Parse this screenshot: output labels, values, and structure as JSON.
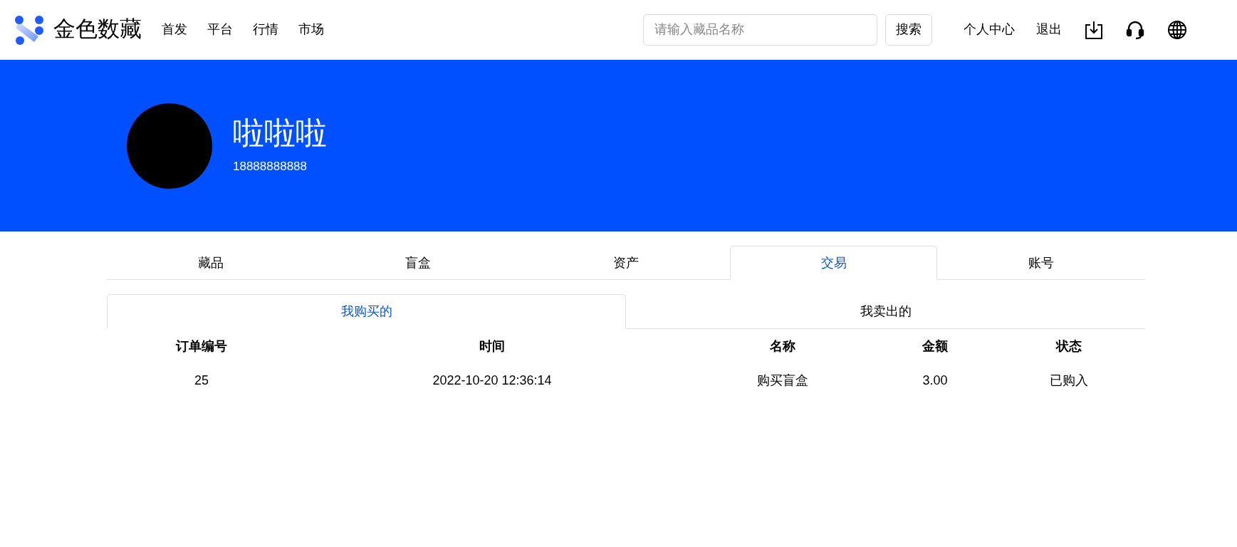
{
  "header": {
    "brand": "金色数藏",
    "nav": [
      "首发",
      "平台",
      "行情",
      "市场"
    ],
    "search": {
      "placeholder": "请输入藏品名称",
      "button": "搜索"
    },
    "links": [
      "个人中心",
      "退出"
    ]
  },
  "profile": {
    "name": "啦啦啦",
    "phone": "18888888888"
  },
  "tabs": [
    {
      "label": "藏品",
      "selected": false
    },
    {
      "label": "盲盒",
      "selected": false
    },
    {
      "label": "资产",
      "selected": false
    },
    {
      "label": "交易",
      "selected": true
    },
    {
      "label": "账号",
      "selected": false
    }
  ],
  "subtabs": [
    {
      "label": "我购买的",
      "selected": true
    },
    {
      "label": "我卖出的",
      "selected": false
    }
  ],
  "table": {
    "columns": [
      "订单编号",
      "时间",
      "名称",
      "金额",
      "状态"
    ],
    "rows": [
      [
        "25",
        "2022-10-20 12:36:14",
        "购买盲盒",
        "3.00",
        "已购入"
      ]
    ]
  }
}
